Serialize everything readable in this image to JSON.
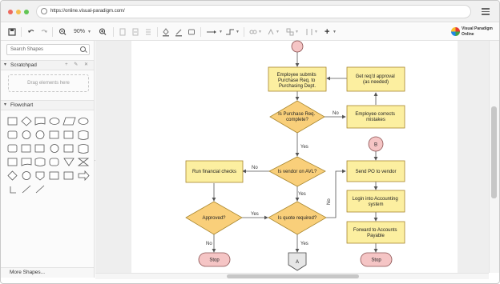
{
  "browser": {
    "url": "https://online.visual-paradigm.com/",
    "dot_colors": [
      "#ed6a5e",
      "#f5bf4f",
      "#62c554"
    ]
  },
  "toolbar": {
    "zoom": "90%",
    "brand_line1": "Visual Paradigm",
    "brand_line2": "Online"
  },
  "sidebar": {
    "search_placeholder": "Search Shapes",
    "scratchpad_label": "Scratchpad",
    "scratchpad_drop": "Drag elements here",
    "flowchart_label": "Flowchart",
    "more_shapes": "More Shapes..."
  },
  "colors": {
    "process_fill": "#fcefa0",
    "process_stroke": "#a8862e",
    "decision_fill": "#f9cf7a",
    "decision_stroke": "#a8862e",
    "terminal_fill": "#f5c5c5",
    "terminal_stroke": "#8a5050",
    "edge": "#555555"
  },
  "diagram": {
    "nodes": {
      "submit": "Employee submits Purchase Req. to Purchasing Dept.",
      "get_approval": "Get req'd approval (as needed)",
      "complete": "Is Purchase Req. complete?",
      "corrects": "Employee corrects mistakes",
      "connector_b": "B",
      "financial": "Run financial checks",
      "vendor": "Is vendor on AVL?",
      "send_po": "Send PO to vendor",
      "approved": "Approved?",
      "quote": "Is quote required?",
      "login": "Login into Accounting system",
      "forward": "Forward to Accounts Payable",
      "stop_left": "Stop",
      "stop_right": "Stop",
      "offpage_a": "A"
    },
    "edges": {
      "no_complete": "No",
      "yes_complete": "Yes",
      "no_vendor": "No",
      "yes_vendor": "Yes",
      "yes_approved": "Yes",
      "no_approved": "No",
      "no_quote": "No",
      "yes_quote": "Yes"
    }
  }
}
